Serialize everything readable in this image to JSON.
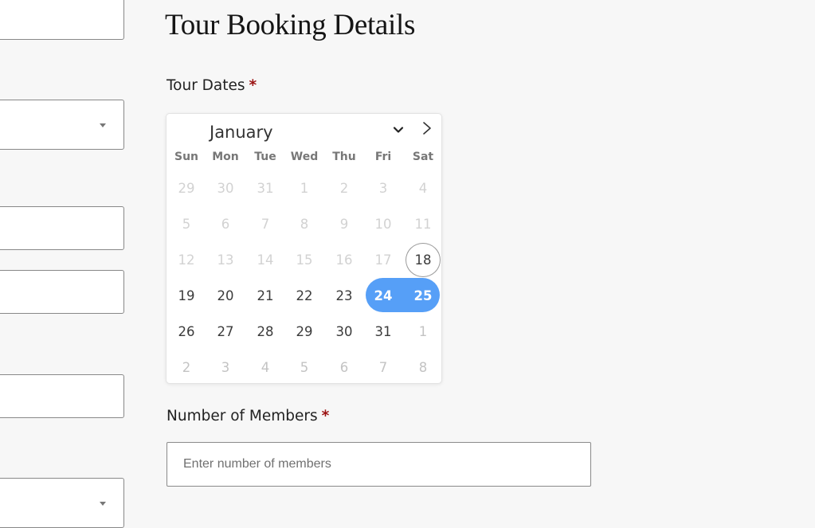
{
  "page": {
    "title": "Tour Booking Details"
  },
  "tour_dates": {
    "label": "Tour Dates",
    "required_mark": "*"
  },
  "calendar": {
    "month": "January",
    "selected_range": [
      24,
      25
    ],
    "today": 18,
    "weekdays": [
      "Sun",
      "Mon",
      "Tue",
      "Wed",
      "Thu",
      "Fri",
      "Sat"
    ],
    "weeks": [
      [
        {
          "label": "29",
          "state": "disabled"
        },
        {
          "label": "30",
          "state": "disabled"
        },
        {
          "label": "31",
          "state": "disabled"
        },
        {
          "label": "1",
          "state": "disabled"
        },
        {
          "label": "2",
          "state": "disabled"
        },
        {
          "label": "3",
          "state": "disabled"
        },
        {
          "label": "4",
          "state": "disabled"
        }
      ],
      [
        {
          "label": "5",
          "state": "disabled"
        },
        {
          "label": "6",
          "state": "disabled"
        },
        {
          "label": "7",
          "state": "disabled"
        },
        {
          "label": "8",
          "state": "disabled"
        },
        {
          "label": "9",
          "state": "disabled"
        },
        {
          "label": "10",
          "state": "disabled"
        },
        {
          "label": "11",
          "state": "disabled"
        }
      ],
      [
        {
          "label": "12",
          "state": "disabled"
        },
        {
          "label": "13",
          "state": "disabled"
        },
        {
          "label": "14",
          "state": "disabled"
        },
        {
          "label": "15",
          "state": "disabled"
        },
        {
          "label": "16",
          "state": "disabled"
        },
        {
          "label": "17",
          "state": "disabled"
        },
        {
          "label": "18",
          "state": "today"
        }
      ],
      [
        {
          "label": "19",
          "state": "available"
        },
        {
          "label": "20",
          "state": "available"
        },
        {
          "label": "21",
          "state": "available"
        },
        {
          "label": "22",
          "state": "available"
        },
        {
          "label": "23",
          "state": "available"
        },
        {
          "label": "24",
          "state": "selected"
        },
        {
          "label": "25",
          "state": "selected"
        }
      ],
      [
        {
          "label": "26",
          "state": "available"
        },
        {
          "label": "27",
          "state": "available"
        },
        {
          "label": "28",
          "state": "available"
        },
        {
          "label": "29",
          "state": "available"
        },
        {
          "label": "30",
          "state": "available"
        },
        {
          "label": "31",
          "state": "available"
        },
        {
          "label": "1",
          "state": "other-month"
        }
      ],
      [
        {
          "label": "2",
          "state": "other-month"
        },
        {
          "label": "3",
          "state": "other-month"
        },
        {
          "label": "4",
          "state": "other-month"
        },
        {
          "label": "5",
          "state": "other-month"
        },
        {
          "label": "6",
          "state": "other-month"
        },
        {
          "label": "7",
          "state": "other-month"
        },
        {
          "label": "8",
          "state": "other-month"
        }
      ]
    ]
  },
  "members": {
    "label": "Number of Members",
    "required_mark": "*",
    "value": "",
    "placeholder": "Enter number of members"
  },
  "icons": {
    "month_dropdown": "chevron-down-icon",
    "next_month": "chevron-right-icon",
    "select_caret": "caret-down-icon"
  },
  "colors": {
    "selected_range": "#569ff7",
    "required_mark": "#9b1212",
    "page_background": "#f7f7f7"
  }
}
